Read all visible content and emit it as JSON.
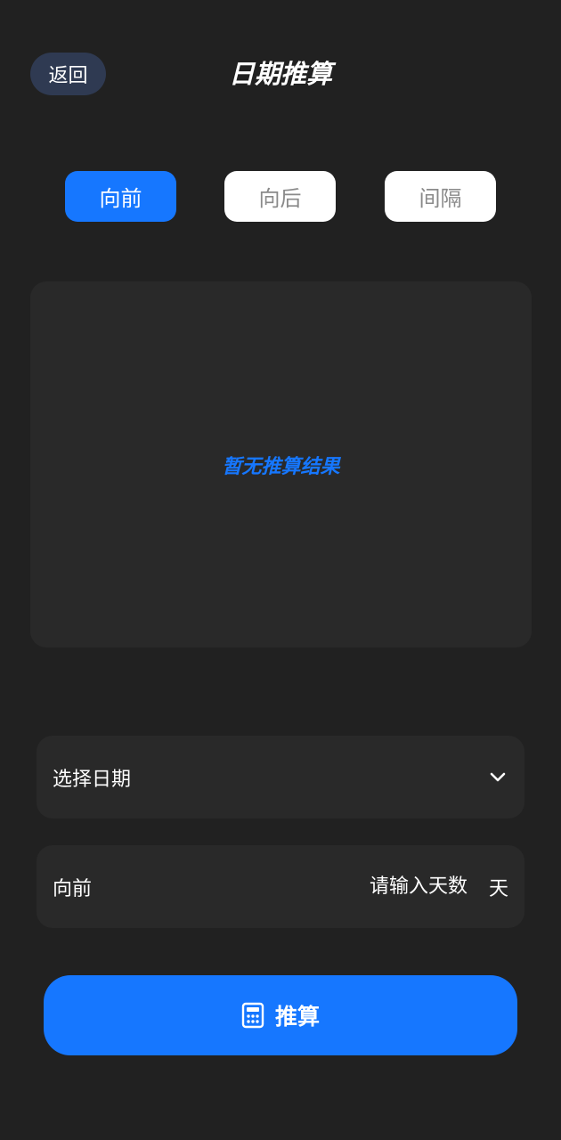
{
  "header": {
    "back_label": "返回",
    "title": "日期推算"
  },
  "tabs": [
    {
      "label": "向前",
      "active": true
    },
    {
      "label": "向后",
      "active": false
    },
    {
      "label": "间隔",
      "active": false
    }
  ],
  "result": {
    "empty_text": "暂无推算结果"
  },
  "date_select": {
    "label": "选择日期",
    "icon": "chevron-down-icon"
  },
  "days_row": {
    "direction_label": "向前",
    "placeholder": "请输入天数",
    "unit": "天"
  },
  "calc_button": {
    "label": "推算",
    "icon": "calculator-icon"
  },
  "colors": {
    "background": "#212121",
    "card": "#292929",
    "accent": "#1677ff",
    "back_button": "#2f3a52"
  }
}
